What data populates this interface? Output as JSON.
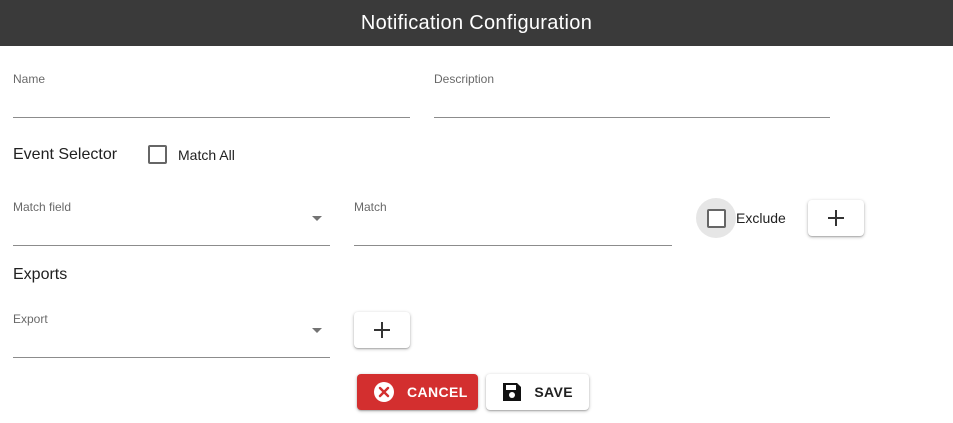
{
  "header": {
    "title": "Notification Configuration"
  },
  "form": {
    "name": {
      "label": "Name",
      "value": ""
    },
    "description": {
      "label": "Description",
      "value": ""
    }
  },
  "event_selector": {
    "title": "Event Selector",
    "match_all_label": "Match All",
    "match_field": {
      "label": "Match field",
      "value": ""
    },
    "match": {
      "label": "Match",
      "value": ""
    },
    "exclude_label": "Exclude"
  },
  "exports": {
    "title": "Exports",
    "export": {
      "label": "Export",
      "value": ""
    }
  },
  "actions": {
    "cancel_label": "CANCEL",
    "save_label": "SAVE"
  },
  "colors": {
    "header_bg": "#3a3a3a",
    "cancel_bg": "#d32f2f"
  },
  "icons": {
    "add": "plus-icon",
    "cancel": "cancel-circle-icon",
    "save": "floppy-disk-icon",
    "dropdown": "arrow-drop-down-icon"
  }
}
